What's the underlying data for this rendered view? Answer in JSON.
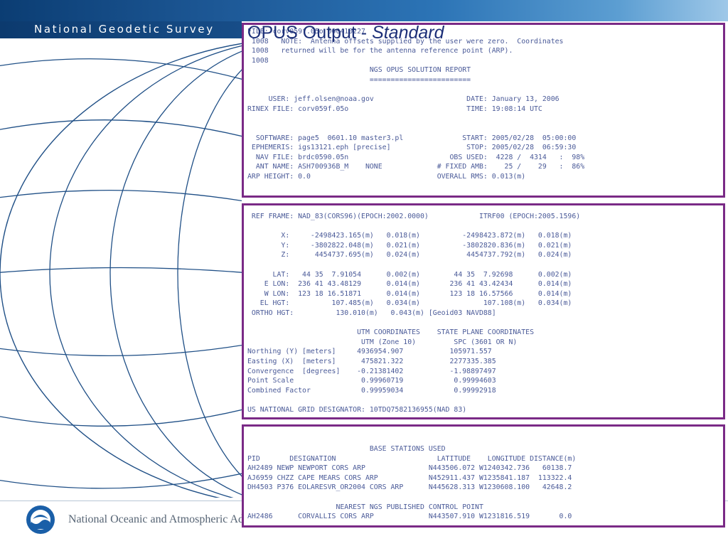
{
  "header": {
    "agency": "National Geodetic Survey"
  },
  "slide": {
    "title_plain": "OPUS Output - ",
    "title_italic": "Standard"
  },
  "footer": {
    "agency": "National Oceanic and Atmospheric Administration"
  },
  "report": {
    "panel1": "FILE: corv059f.05o 000410227\n 1008   NOTE:  Antenna offsets supplied by the user were zero.  Coordinates\n 1008   returned will be for the antenna reference point (ARP).\n 1008\n                             NGS OPUS SOLUTION REPORT\n                             ========================\n\n     USER: jeff.olsen@noaa.gov                      DATE: January 13, 2006\nRINEX FILE: corv059f.05o                            TIME: 19:08:14 UTC\n\n\n  SOFTWARE: page5  0601.10 master3.pl              START: 2005/02/28  05:00:00\n EPHEMERIS: igs13121.eph [precise]                  STOP: 2005/02/28  06:59:30\n  NAV FILE: brdc0590.05n                        OBS USED:  4228 /  4314   :  98%\n  ANT NAME: ASH700936B_M    NONE             # FIXED AMB:    25 /    29   :  86%\nARP HEIGHT: 0.0                              OVERALL RMS: 0.013(m)",
    "panel2": " REF FRAME: NAD_83(CORS96)(EPOCH:2002.0000)            ITRF00 (EPOCH:2005.1596)\n\n        X:     -2498423.165(m)   0.018(m)          -2498423.872(m)   0.018(m)\n        Y:     -3802822.048(m)   0.021(m)          -3802820.836(m)   0.021(m)\n        Z:      4454737.695(m)   0.024(m)           4454737.792(m)   0.024(m)\n\n      LAT:   44 35  7.91054      0.002(m)        44 35  7.92698      0.002(m)\n    E LON:  236 41 43.48129      0.014(m)       236 41 43.42434      0.014(m)\n    W LON:  123 18 16.51871      0.014(m)       123 18 16.57566      0.014(m)\n   EL HGT:          107.485(m)   0.034(m)               107.108(m)   0.034(m)\n ORTHO HGT:          130.010(m)   0.043(m) [Geoid03 NAVD88]\n\n                          UTM COORDINATES    STATE PLANE COORDINATES\n                           UTM (Zone 10)         SPC (3601 OR N)\nNorthing (Y) [meters]     4936954.907           105971.557\nEasting (X)  [meters]      475821.322           2277335.385\nConvergence  [degrees]    -0.21381402           -1.98897497\nPoint Scale                0.99960719            0.99994603\nCombined Factor            0.99959034            0.99992918\n\nUS NATIONAL GRID DESIGNATOR: 10TDQ7582136955(NAD 83)",
    "panel3": "                             BASE STATIONS USED\nPID       DESIGNATION                        LATITUDE    LONGITUDE DISTANCE(m)\nAH2489 NEWP NEWPORT CORS ARP               N443506.072 W1240342.736   60138.7\nAJ6959 CHZZ CAPE MEARS CORS ARP            N452911.437 W1235841.187  113322.4\nDH4503 P376 EOLARESVR_OR2004 CORS ARP      N445628.313 W1230608.100   42648.2\n\n                     NEAREST NGS PUBLISHED CONTROL POINT\nAH2486      CORVALLIS CORS ARP             N443507.910 W1231816.519       0.0"
  }
}
